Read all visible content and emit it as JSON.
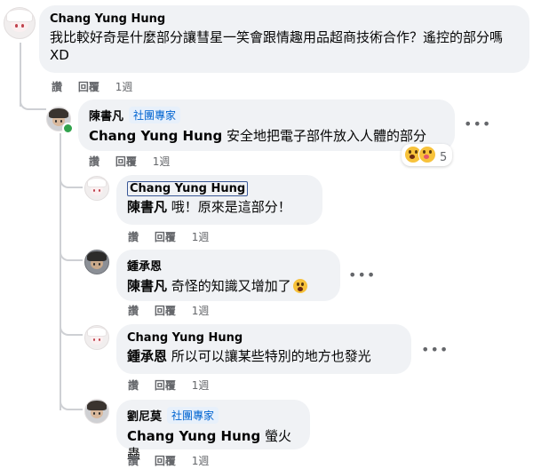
{
  "comments": [
    {
      "author": "Chang Yung Hung",
      "text": "我比較好奇是什麼部分讓彗星一笑會跟情趣用品超商技術合作？遙控的部分嗎XD",
      "actions": {
        "like": "讚",
        "reply": "回覆",
        "time": "1週"
      }
    },
    {
      "author": "陳書凡",
      "badge": "社團專家",
      "mention": "Chang Yung Hung",
      "text": "安全地把電子部件放入人體的部分",
      "reactions": {
        "count": "5"
      },
      "actions": {
        "like": "讚",
        "reply": "回覆",
        "time": "1週"
      }
    },
    {
      "author": "Chang Yung Hung",
      "mention": "陳書凡",
      "text": "哦！原來是這部分！",
      "actions": {
        "like": "讚",
        "reply": "回覆",
        "time": "1週"
      }
    },
    {
      "author": "鍾承恩",
      "mention": "陳書凡",
      "text": "奇怪的知識又增加了",
      "actions": {
        "like": "讚",
        "reply": "回覆",
        "time": "1週"
      }
    },
    {
      "author": "Chang Yung Hung",
      "mention": "鍾承恩",
      "text": "所以可以讓某些特別的地方也發光",
      "actions": {
        "like": "讚",
        "reply": "回覆",
        "time": "1週"
      }
    },
    {
      "author": "劉尼莫",
      "badge": "社團專家",
      "mention": "Chang Yung Hung",
      "text": "螢火蟲",
      "actions": {
        "like": "讚",
        "reply": "回覆",
        "time": "1週"
      }
    }
  ],
  "more_icon": "more-horizontal-icon",
  "colors": {
    "bubble": "#f0f2f5",
    "badge_text": "#0064d1",
    "badge_bg": "#e7f0fb",
    "online": "#31a24c"
  }
}
